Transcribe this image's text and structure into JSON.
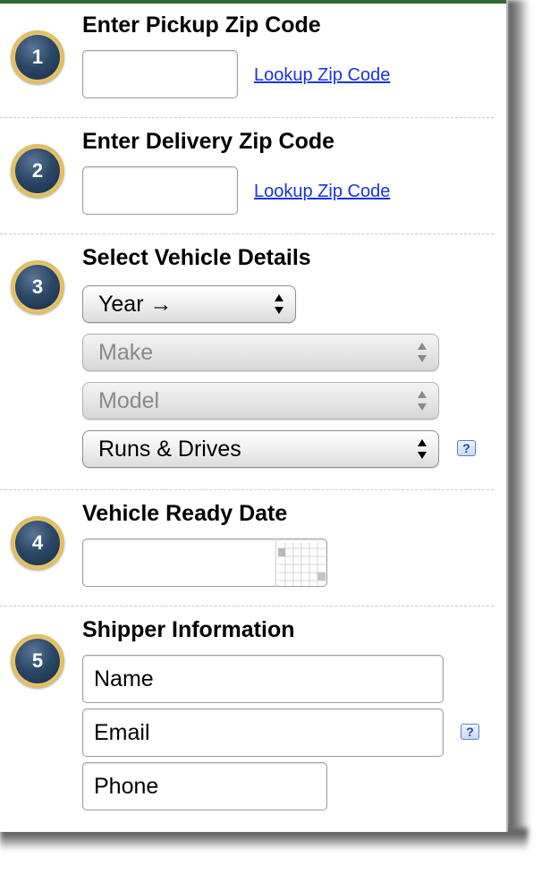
{
  "steps": {
    "step1": {
      "number": "1",
      "title": "Enter Pickup Zip Code",
      "zip_value": "",
      "link": "Lookup Zip Code"
    },
    "step2": {
      "number": "2",
      "title": "Enter Delivery Zip Code",
      "zip_value": "",
      "link": "Lookup Zip Code"
    },
    "step3": {
      "number": "3",
      "title": "Select Vehicle Details",
      "year_select": "Year →",
      "make_select": "Make",
      "model_select": "Model",
      "condition_select": "Runs & Drives",
      "help": "?"
    },
    "step4": {
      "number": "4",
      "title": "Vehicle Ready Date",
      "date_value": ""
    },
    "step5": {
      "number": "5",
      "title": "Shipper Information",
      "name_placeholder": "Name",
      "email_placeholder": "Email",
      "phone_placeholder": "Phone",
      "help": "?"
    }
  },
  "colors": {
    "accent_green": "#2f6a33",
    "badge_navy": "#1f3a5c",
    "badge_gold": "#e6c46c",
    "link_blue": "#1a33e0"
  },
  "icons": [
    "calendar-icon",
    "help-icon",
    "select-arrows-icon"
  ]
}
